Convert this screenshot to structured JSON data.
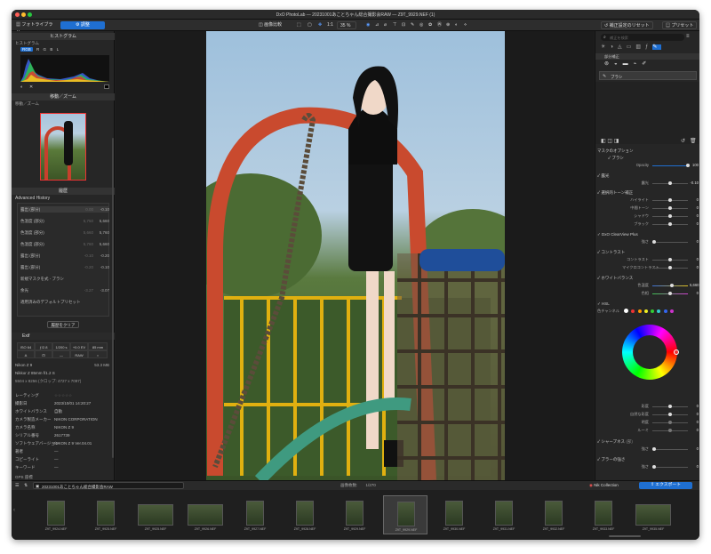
{
  "window": {
    "title": "DxO PhotoLab — 20231001あことちゃん総合撮影会RAW — Z9T_9929.NEF (1)"
  },
  "tabs": {
    "library": "フォトライブラリ",
    "customize": "調整"
  },
  "toolbar": {
    "compare": "画像比較",
    "ratio": "1:1",
    "zoom": "35 %",
    "reset": "補正設定のリセット",
    "preset": "プリセット"
  },
  "left": {
    "histogram": {
      "title": "ヒストグラム",
      "channels": [
        "RGB",
        "R",
        "G",
        "B",
        "L"
      ]
    },
    "navigator": {
      "title": "移動／ズーム"
    },
    "history": {
      "title": "履歴",
      "header": "Advanced History",
      "items": [
        {
          "label": "露出 (部分)",
          "mid": "0.00",
          "val": "-0.10"
        },
        {
          "label": "色温度 (部分)",
          "mid": "5,750",
          "val": "5,660"
        },
        {
          "label": "色温度 (部分)",
          "mid": "5,660",
          "val": "5,760"
        },
        {
          "label": "色温度 (部分)",
          "mid": "5,760",
          "val": "5,660"
        },
        {
          "label": "露出 (部分)",
          "mid": "-0.10",
          "val": "-0.20"
        },
        {
          "label": "露出 (部分)",
          "mid": "-0.20",
          "val": "-0.10"
        },
        {
          "label": "新規マスクを式 - ブラシ",
          "mid": "",
          "val": ""
        },
        {
          "label": "余光",
          "mid": "-3.27",
          "val": "-3.07"
        },
        {
          "label": "適用済みのデフォルトプリセット",
          "mid": "",
          "val": ""
        }
      ],
      "button": "履歴をクリア"
    },
    "exif": {
      "title": "Exif",
      "grid": [
        "ISO 64",
        "ƒ/2.8",
        "1/200 s",
        "+0.0 EV",
        "85 mm",
        "A",
        "",
        "—",
        "RAW",
        "○"
      ],
      "camera": "Nikon Z 9",
      "size": "53.3 MB",
      "lens": "Nikkor Z 85mm f/1.2 S",
      "dims": "5504 x 8256 (クロップ: 4727 x 7097)",
      "fields": [
        {
          "k": "レーティング",
          "v": "☆☆☆☆☆"
        },
        {
          "k": "撮影日",
          "v": "2023/10/01 14:20:27"
        },
        {
          "k": "ホワイトバランス",
          "v": "自動"
        },
        {
          "k": "カメラ製造メーカー",
          "v": "NIKON CORPORATION"
        },
        {
          "k": "カメラ名称",
          "v": "NIKON Z 9"
        },
        {
          "k": "シリアル番号",
          "v": "2617739"
        },
        {
          "k": "ソフトウェアバージョン",
          "v": "NIKON Z 9 Ver.04.01"
        },
        {
          "k": "著者",
          "v": "—"
        },
        {
          "k": "コピーライト",
          "v": "—"
        },
        {
          "k": "キーワード",
          "v": "—"
        }
      ]
    },
    "gps": "GPS 座標"
  },
  "right": {
    "search_placeholder": "補正を検索",
    "local": "部分補正",
    "brush": "ブラシ",
    "mask_options": "マスクのオプション",
    "brush_sub": "ブラシ",
    "opacity_label": "Opacity",
    "opacity_val": "100",
    "exposure": {
      "title": "露光",
      "rows": [
        {
          "k": "露光",
          "v": "-0.10"
        }
      ]
    },
    "tone": {
      "title": "選択的トーン補正",
      "rows": [
        {
          "k": "ハイライト",
          "v": "0"
        },
        {
          "k": "中間トーン",
          "v": "0"
        },
        {
          "k": "シャドウ",
          "v": "0"
        },
        {
          "k": "ブラック",
          "v": "0"
        }
      ]
    },
    "clearview": {
      "title": "DxO ClearView Plus",
      "rows": [
        {
          "k": "強さ",
          "v": "0"
        }
      ]
    },
    "contrast": {
      "title": "コントラスト",
      "rows": [
        {
          "k": "コントラスト",
          "v": "0"
        },
        {
          "k": "マイクロコントラスト",
          "v": "0"
        }
      ]
    },
    "wb": {
      "title": "ホワイトバランス",
      "rows": [
        {
          "k": "色温度",
          "v": "5,660"
        },
        {
          "k": "色相",
          "v": "0"
        }
      ]
    },
    "hsl": {
      "title": "HSL",
      "channel": "色チャンネル"
    },
    "hsl_rows": [
      {
        "k": "彩度",
        "v": "0"
      },
      {
        "k": "自然な彩度",
        "v": "0"
      },
      {
        "k": "明度",
        "v": "0"
      },
      {
        "k": "ルーミ",
        "v": "0"
      }
    ],
    "sharpness": {
      "title": "シャープネス",
      "tag": "(部)",
      "rows": [
        {
          "k": "強さ",
          "v": "0"
        }
      ]
    },
    "blur": {
      "title": "ブラーの強さ",
      "rows": [
        {
          "k": "強さ",
          "v": "0"
        }
      ]
    }
  },
  "filmbar": {
    "folder": "20231001あことちゃん総合撮影会RAW",
    "count_label": "画像枚数:",
    "count": "1/270",
    "nik": "Nik Collection",
    "export": "エクスポート"
  },
  "thumbs": [
    "Z9T_9924.NEF",
    "Z9T_9925.NEF",
    "Z9T_9925.NEF",
    "Z9T_9926.NEF",
    "Z9T_9927.NEF",
    "Z9T_9928.NEF",
    "Z9T_9929.NEF",
    "Z9T_9929.NEF",
    "Z9T_9930.NEF",
    "Z9T_9931.NEF",
    "Z9T_9932.NEF",
    "Z9T_9933.NEF",
    "Z9T_9935.NEF"
  ],
  "colors": {
    "accent": "#1f6fd1",
    "panel": "#262626",
    "bg": "#1b1b1b"
  }
}
